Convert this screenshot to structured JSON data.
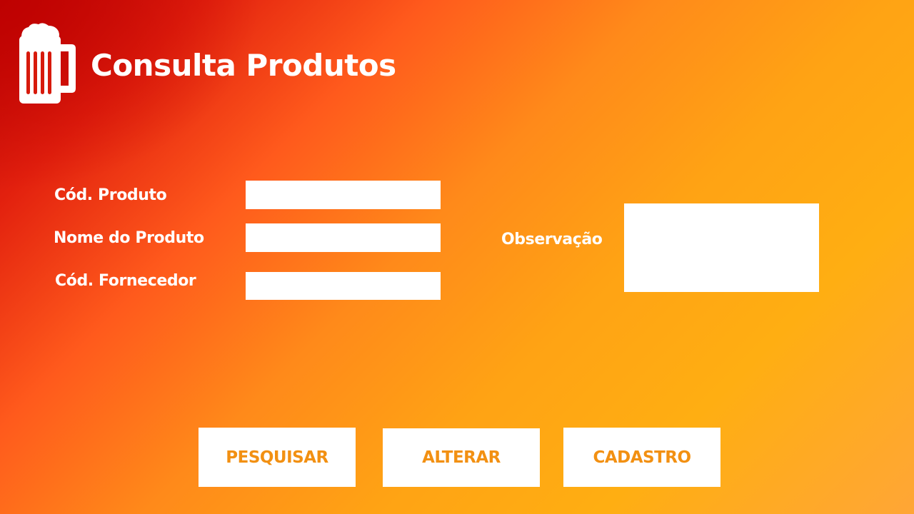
{
  "header": {
    "title": "Consulta Produtos",
    "logo_icon": "beer-mug-icon"
  },
  "form": {
    "codigo_produto": {
      "label": "Cód. Produto",
      "value": ""
    },
    "nome_produto": {
      "label": "Nome do Produto",
      "value": ""
    },
    "codigo_fornecedor": {
      "label": "Cód. Fornecedor",
      "value": ""
    },
    "observacao": {
      "label": "Observação",
      "value": ""
    }
  },
  "actions": {
    "pesquisar": "PESQUISAR",
    "alterar": "ALTERAR",
    "cadastro": "CADASTRO"
  },
  "colors": {
    "gradient_start": "#c00606",
    "gradient_mid": "#ff5a1c",
    "gradient_end": "#ffae12",
    "button_text": "#f29012",
    "field_background": "#ffffff"
  }
}
